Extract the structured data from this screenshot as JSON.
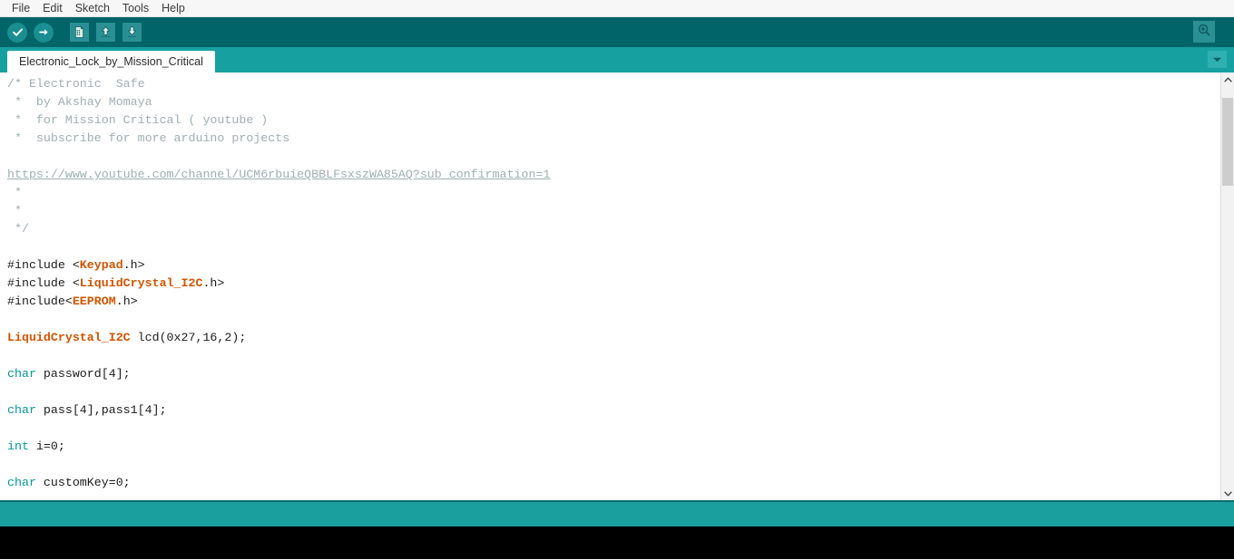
{
  "menubar": {
    "items": [
      {
        "label": "File"
      },
      {
        "label": "Edit"
      },
      {
        "label": "Sketch"
      },
      {
        "label": "Tools"
      },
      {
        "label": "Help"
      }
    ]
  },
  "toolbar": {
    "verify_label": "Verify",
    "upload_label": "Upload",
    "new_label": "New",
    "open_label": "Open",
    "save_label": "Save",
    "serial_monitor_label": "Serial Monitor",
    "background_color": "#006468",
    "button_color": "#2a9094"
  },
  "tabbar": {
    "active_tab": "Electronic_Lock_by_Mission_Critical",
    "menu_button_label": "",
    "background_color": "#17a0a0"
  },
  "editor": {
    "lines": [
      {
        "segments": [
          {
            "text": "/* Electronic  Safe",
            "cls": "cmt"
          }
        ]
      },
      {
        "segments": [
          {
            "text": " *  by Akshay Momaya",
            "cls": "cmt"
          }
        ]
      },
      {
        "segments": [
          {
            "text": " *  for Mission Critical ( youtube )",
            "cls": "cmt"
          }
        ]
      },
      {
        "segments": [
          {
            "text": " *  subscribe for more arduino projects",
            "cls": "cmt"
          }
        ]
      },
      {
        "segments": [
          {
            "text": "",
            "cls": "cmt"
          }
        ]
      },
      {
        "segments": [
          {
            "text": "https://www.youtube.com/channel/UCM6rbuieQBBLFsxszWA85AQ?sub_confirmation=1",
            "cls": "link"
          }
        ]
      },
      {
        "segments": [
          {
            "text": " *",
            "cls": "cmt"
          }
        ]
      },
      {
        "segments": [
          {
            "text": " *",
            "cls": "cmt"
          }
        ]
      },
      {
        "segments": [
          {
            "text": " */",
            "cls": "cmt"
          }
        ]
      },
      {
        "segments": [
          {
            "text": "",
            "cls": ""
          }
        ]
      },
      {
        "segments": [
          {
            "text": "#include <",
            "cls": ""
          },
          {
            "text": "Keypad",
            "cls": "lib"
          },
          {
            "text": ".h>",
            "cls": ""
          }
        ]
      },
      {
        "segments": [
          {
            "text": "#include <",
            "cls": ""
          },
          {
            "text": "LiquidCrystal_I2C",
            "cls": "lib"
          },
          {
            "text": ".h>",
            "cls": ""
          }
        ]
      },
      {
        "segments": [
          {
            "text": "#include<",
            "cls": ""
          },
          {
            "text": "EEPROM",
            "cls": "lib"
          },
          {
            "text": ".h>",
            "cls": ""
          }
        ]
      },
      {
        "segments": [
          {
            "text": "",
            "cls": ""
          }
        ]
      },
      {
        "segments": [
          {
            "text": "LiquidCrystal_I2C",
            "cls": "type"
          },
          {
            "text": " lcd(0x27,16,2);",
            "cls": ""
          }
        ]
      },
      {
        "segments": [
          {
            "text": "",
            "cls": ""
          }
        ]
      },
      {
        "segments": [
          {
            "text": "char",
            "cls": "kw"
          },
          {
            "text": " password[4];",
            "cls": ""
          }
        ]
      },
      {
        "segments": [
          {
            "text": "",
            "cls": ""
          }
        ]
      },
      {
        "segments": [
          {
            "text": "char",
            "cls": "kw"
          },
          {
            "text": " pass[4],pass1[4];",
            "cls": ""
          }
        ]
      },
      {
        "segments": [
          {
            "text": "",
            "cls": ""
          }
        ]
      },
      {
        "segments": [
          {
            "text": "int",
            "cls": "kw"
          },
          {
            "text": " i=0;",
            "cls": ""
          }
        ]
      },
      {
        "segments": [
          {
            "text": "",
            "cls": ""
          }
        ]
      },
      {
        "segments": [
          {
            "text": "char",
            "cls": "kw"
          },
          {
            "text": " customKey=0;",
            "cls": ""
          }
        ]
      }
    ],
    "colors": {
      "comment": "#a0aeb2",
      "keyword": "#00979c",
      "library": "#d35400",
      "text": "#1b1b1b",
      "background": "#ffffff"
    }
  },
  "scrollbar": {
    "up_label": "",
    "down_label": "",
    "thumb_position_percent": 3,
    "thumb_size_percent": 22
  },
  "statusbar": {
    "message": "",
    "background_color": "#1a9e9e"
  },
  "console": {
    "text": "",
    "background_color": "#000000"
  }
}
